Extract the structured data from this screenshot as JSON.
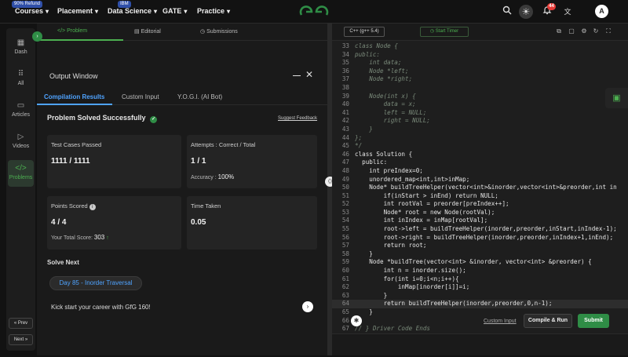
{
  "topnav": {
    "items": [
      {
        "label": "Courses",
        "badge": "90% Refund"
      },
      {
        "label": "Placement",
        "badge": ""
      },
      {
        "label": "Data Science",
        "badge": "IBM"
      },
      {
        "label": "GATE",
        "badge": ""
      },
      {
        "label": "Practice",
        "badge": ""
      }
    ],
    "notification_count": "44",
    "avatar_initial": "A",
    "brand_color": "#2f8d46"
  },
  "sidebar": {
    "items": [
      {
        "label": "Dash",
        "icon": "dashboard-icon"
      },
      {
        "label": "All",
        "icon": "grid-icon"
      },
      {
        "label": "Articles",
        "icon": "book-icon"
      },
      {
        "label": "Videos",
        "icon": "play-icon"
      },
      {
        "label": "Problems",
        "icon": "code-icon"
      }
    ],
    "prev_label": "« Prev",
    "next_label": "Next »"
  },
  "problem_tabs": [
    {
      "label": "</> Problem"
    },
    {
      "label": "Editorial"
    },
    {
      "label": "Submissions"
    }
  ],
  "output": {
    "title": "Output Window",
    "tabs": [
      {
        "label": "Compilation Results"
      },
      {
        "label": "Custom Input"
      },
      {
        "label": "Y.O.G.I. (AI Bot)"
      }
    ],
    "status": "Problem Solved Successfully",
    "feedback_link": "Suggest Feedback",
    "cards": {
      "test_cases": {
        "label": "Test Cases Passed",
        "value": "1111 / 1111"
      },
      "attempts": {
        "label": "Attempts : Correct / Total",
        "value": "1 / 1",
        "sub_label": "Accuracy :",
        "sub_value": "100%"
      },
      "points": {
        "label": "Points Scored",
        "value": "4 / 4",
        "sub_label": "Your Total Score:",
        "sub_value": "303"
      },
      "time": {
        "label": "Time Taken",
        "value": "0.05"
      }
    },
    "solve_next": "Solve Next",
    "next_problem": "Day 85 - Inorder Traversal",
    "promo": "Kick start your career with GfG 160!"
  },
  "editor": {
    "language": "C++ (g++ 5.4)",
    "timer_label": "Start Timer",
    "lines": [
      {
        "n": "33",
        "t": "class Node {",
        "cls": "cm"
      },
      {
        "n": "34",
        "t": "public:",
        "cls": "cm"
      },
      {
        "n": "35",
        "t": "    int data;",
        "cls": "cm"
      },
      {
        "n": "36",
        "t": "    Node *left;",
        "cls": "cm"
      },
      {
        "n": "37",
        "t": "    Node *right;",
        "cls": "cm"
      },
      {
        "n": "38",
        "t": "",
        "cls": "cm"
      },
      {
        "n": "39",
        "t": "    Node(int x) {",
        "cls": "cm"
      },
      {
        "n": "40",
        "t": "        data = x;",
        "cls": "cm"
      },
      {
        "n": "41",
        "t": "        left = NULL;",
        "cls": "cm"
      },
      {
        "n": "42",
        "t": "        right = NULL;",
        "cls": "cm"
      },
      {
        "n": "43",
        "t": "    }",
        "cls": "cm"
      },
      {
        "n": "44",
        "t": "};",
        "cls": "cm"
      },
      {
        "n": "45",
        "t": "*/",
        "cls": "cm"
      },
      {
        "n": "46",
        "t": "class Solution {",
        "cls": "txt"
      },
      {
        "n": "47",
        "t": "  public:",
        "cls": "txt"
      },
      {
        "n": "48",
        "t": "    int preIndex=0;",
        "cls": "txt"
      },
      {
        "n": "49",
        "t": "    unordered_map<int,int>inMap;",
        "cls": "txt"
      },
      {
        "n": "50",
        "t": "    Node* buildTreeHelper(vector<int>&inorder,vector<int>&preorder,int in",
        "cls": "txt"
      },
      {
        "n": "51",
        "t": "        if(inStart > inEnd) return NULL;",
        "cls": "txt"
      },
      {
        "n": "52",
        "t": "        int rootVal = preorder[preIndex++];",
        "cls": "txt"
      },
      {
        "n": "53",
        "t": "        Node* root = new Node(rootVal);",
        "cls": "txt"
      },
      {
        "n": "54",
        "t": "        int inIndex = inMap[rootVal];",
        "cls": "txt"
      },
      {
        "n": "55",
        "t": "        root->left = buildTreeHelper(inorder,preorder,inStart,inIndex-1);",
        "cls": "txt"
      },
      {
        "n": "56",
        "t": "        root->right = buildTreeHelper(inorder,preorder,inIndex+1,inEnd);",
        "cls": "txt"
      },
      {
        "n": "57",
        "t": "        return root;",
        "cls": "txt"
      },
      {
        "n": "58",
        "t": "    }",
        "cls": "txt"
      },
      {
        "n": "59",
        "t": "    Node *buildTree(vector<int> &inorder, vector<int> &preorder) {",
        "cls": "txt"
      },
      {
        "n": "60",
        "t": "        int n = inorder.size();",
        "cls": "txt"
      },
      {
        "n": "61",
        "t": "        for(int i=0;i<n;i++){",
        "cls": "txt"
      },
      {
        "n": "62",
        "t": "            inMap[inorder[i]]=i;",
        "cls": "txt"
      },
      {
        "n": "63",
        "t": "        }",
        "cls": "txt"
      },
      {
        "n": "64",
        "t": "        return buildTreeHelper(inorder,preorder,0,n-1);",
        "cls": "txt hl"
      },
      {
        "n": "65",
        "t": "    }",
        "cls": "txt"
      },
      {
        "n": "66",
        "t": "};",
        "cls": "txt"
      },
      {
        "n": "67",
        "t": "// } Driver Code Ends",
        "cls": "cm"
      }
    ],
    "custom_input_label": "Custom Input",
    "compile_label": "Compile & Run",
    "submit_label": "Submit"
  }
}
